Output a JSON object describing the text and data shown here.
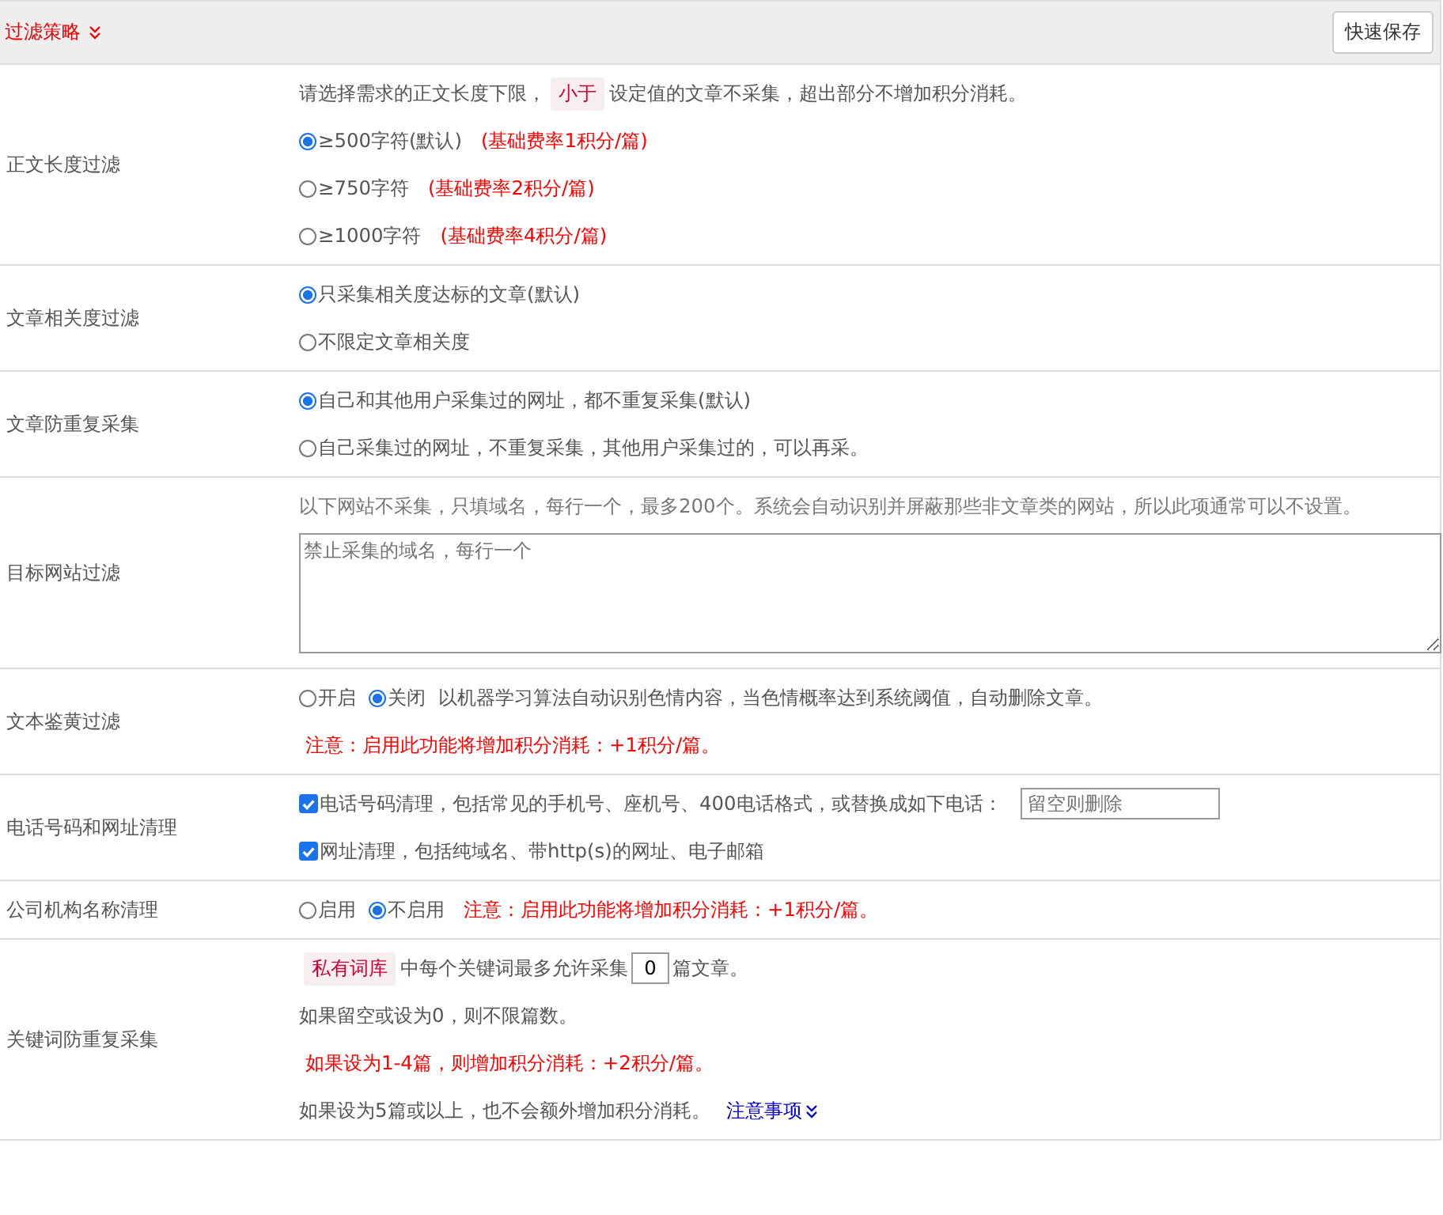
{
  "header": {
    "title": "过滤策略",
    "save_button": "快速保存"
  },
  "rows": [
    {
      "label": "正文长度过滤",
      "lines": [
        [
          {
            "kind": "text",
            "text": "请选择需求的正文长度下限，"
          },
          {
            "kind": "tag",
            "text": "小于"
          },
          {
            "kind": "text",
            "text": "设定值的文章不采集，超出部分不增加积分消耗。"
          }
        ],
        [
          {
            "kind": "radio",
            "text": "≥500字符(默认)",
            "selected": true
          },
          {
            "kind": "note",
            "text": "(基础费率1积分/篇)"
          }
        ],
        [
          {
            "kind": "radio",
            "text": "≥750字符",
            "selected": false
          },
          {
            "kind": "note",
            "text": "(基础费率2积分/篇)"
          }
        ],
        [
          {
            "kind": "radio",
            "text": "≥1000字符",
            "selected": false
          },
          {
            "kind": "note",
            "text": "(基础费率4积分/篇)"
          }
        ]
      ]
    },
    {
      "label": "文章相关度过滤",
      "lines": [
        [
          {
            "kind": "radio",
            "text": "只采集相关度达标的文章(默认)",
            "selected": true
          }
        ],
        [
          {
            "kind": "radio",
            "text": "不限定文章相关度",
            "selected": false
          }
        ]
      ]
    },
    {
      "label": "文章防重复采集",
      "lines": [
        [
          {
            "kind": "radio",
            "text": "自己和其他用户采集过的网址，都不重复采集(默认)",
            "selected": true
          }
        ],
        [
          {
            "kind": "radio",
            "text": "自己采集过的网址，不重复采集，其他用户采集过的，可以再采。",
            "selected": false
          }
        ]
      ]
    },
    {
      "label": "目标网站过滤",
      "lines": [
        [
          {
            "kind": "hint",
            "text": "以下网站不采集，只填域名，每行一个，最多200个。系统会自动识别并屏蔽那些非文章类的网站，所以此项通常可以不设置。"
          }
        ],
        [
          {
            "kind": "textarea",
            "placeholder": "禁止采集的域名，每行一个"
          }
        ]
      ]
    },
    {
      "label": "文本鉴黄过滤",
      "lines": [
        [
          {
            "kind": "radio",
            "text": "开启",
            "selected": false
          },
          {
            "kind": "radio",
            "text": "关闭",
            "selected": true
          },
          {
            "kind": "text",
            "text": "以机器学习算法自动识别色情内容，当色情概率达到系统阈值，自动删除文章。"
          }
        ],
        [
          {
            "kind": "note",
            "text": "注意：启用此功能将增加积分消耗：+1积分/篇。"
          }
        ]
      ]
    },
    {
      "label": "电话号码和网址清理",
      "lines": [
        [
          {
            "kind": "checkbox",
            "text": "电话号码清理，包括常见的手机号、座机号、400电话格式，或替换成如下电话：",
            "checked": true
          },
          {
            "kind": "input",
            "placeholder": "留空则删除"
          }
        ],
        [
          {
            "kind": "checkbox",
            "text": "网址清理，包括纯域名、带http(s)的网址、电子邮箱",
            "checked": true
          }
        ]
      ]
    },
    {
      "label": "公司机构名称清理",
      "lines": [
        [
          {
            "kind": "radio",
            "text": "启用",
            "selected": false
          },
          {
            "kind": "radio",
            "text": "不启用",
            "selected": true
          },
          {
            "kind": "note",
            "text": "注意：启用此功能将增加积分消耗：+1积分/篇。"
          }
        ]
      ]
    },
    {
      "label": "关键词防重复采集",
      "lines": [
        [
          {
            "kind": "tag",
            "text": "私有词库"
          },
          {
            "kind": "text",
            "text": "中每个关键词最多允许采集"
          },
          {
            "kind": "number",
            "value": "0"
          },
          {
            "kind": "text",
            "text": "篇文章。"
          }
        ],
        [
          {
            "kind": "text",
            "text": "如果留空或设为0，则不限篇数。"
          }
        ],
        [
          {
            "kind": "note",
            "text": "如果设为1-4篇，则增加积分消耗：+2积分/篇。"
          }
        ],
        [
          {
            "kind": "text",
            "text": "如果设为5篇或以上，也不会额外增加积分消耗。"
          },
          {
            "kind": "link",
            "text": "注意事项"
          }
        ]
      ]
    }
  ]
}
